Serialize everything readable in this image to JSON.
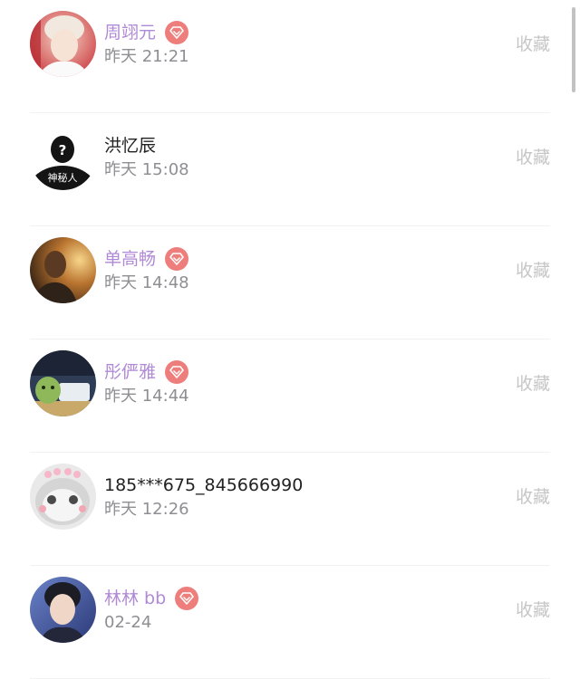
{
  "collect_label": "收藏",
  "badge_color": "#ee7e7b",
  "vip_name_color": "#b08ad6",
  "users": [
    {
      "name": "周翊元",
      "time": "昨天 21:21",
      "vip": true,
      "avatar": "avatar-photo-blond-person"
    },
    {
      "name": "洪忆辰",
      "time": "昨天 15:08",
      "vip": false,
      "avatar": "avatar-mystery-silhouette",
      "avatar_caption": "神秘人"
    },
    {
      "name": "单高畅",
      "time": "昨天 14:48",
      "vip": true,
      "avatar": "avatar-photo-sunset-portrait"
    },
    {
      "name": "彤俨雅",
      "time": "昨天 14:44",
      "vip": true,
      "avatar": "avatar-photo-cartoon-toy"
    },
    {
      "name": "185***675_845666990",
      "time": "昨天 12:26",
      "vip": false,
      "avatar": "avatar-photo-cat"
    },
    {
      "name": "林林 bb",
      "time": "02-24",
      "vip": true,
      "avatar": "avatar-photo-young-man"
    }
  ]
}
